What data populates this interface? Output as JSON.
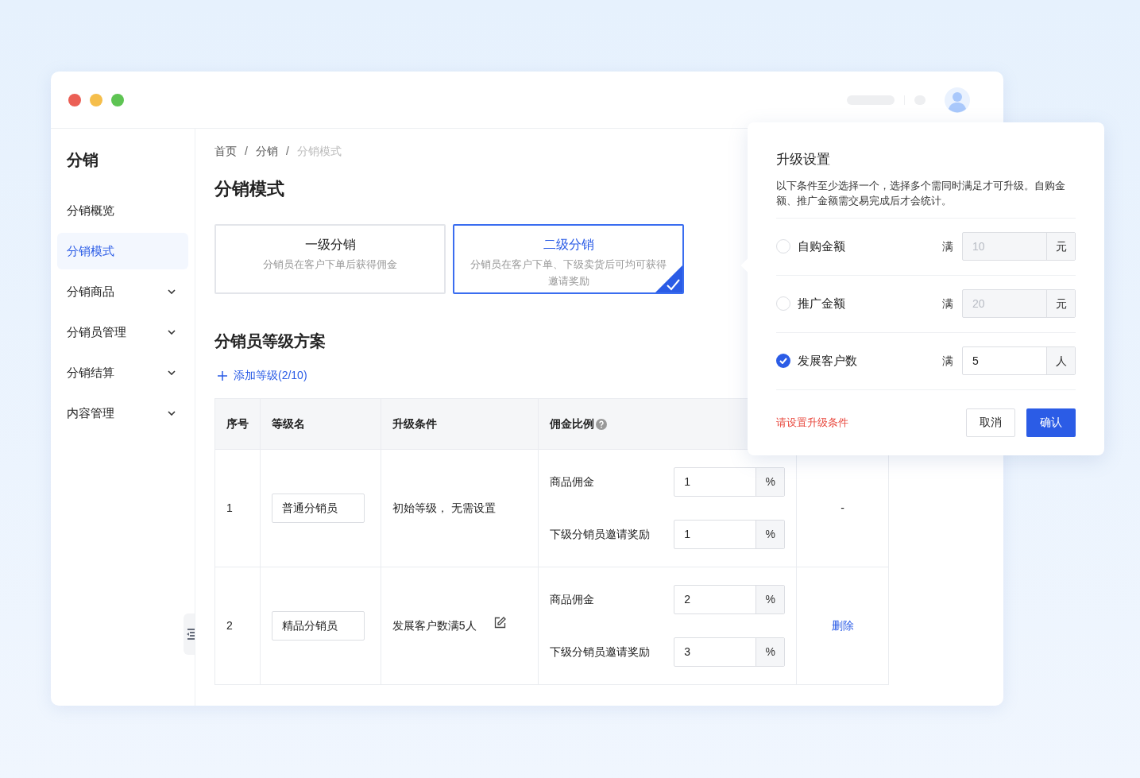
{
  "sidebar": {
    "title": "分销",
    "items": [
      {
        "label": "分销概览",
        "selected": false,
        "has_submenu": false
      },
      {
        "label": "分销模式",
        "selected": true,
        "has_submenu": false
      },
      {
        "label": "分销商品",
        "selected": false,
        "has_submenu": true
      },
      {
        "label": "分销员管理",
        "selected": false,
        "has_submenu": true
      },
      {
        "label": "分销结算",
        "selected": false,
        "has_submenu": true
      },
      {
        "label": "内容管理",
        "selected": false,
        "has_submenu": true
      }
    ]
  },
  "breadcrumb": {
    "separator": "/",
    "items": [
      {
        "label": "首页",
        "current": false
      },
      {
        "label": "分销",
        "current": false
      },
      {
        "label": "分销模式",
        "current": true
      }
    ]
  },
  "page_title": "分销模式",
  "modes": [
    {
      "title": "一级分销",
      "description": "分销员在客户下单后获得佣金",
      "selected": false
    },
    {
      "title": "二级分销",
      "description": "分销员在客户下单、下级卖货后可均可获得邀请奖励",
      "selected": true
    }
  ],
  "section_title": "分销员等级方案",
  "add_button": "添加等级(2/10)",
  "table": {
    "columns": [
      {
        "label": "序号",
        "help": false
      },
      {
        "label": "等级名",
        "help": false
      },
      {
        "label": "升级条件",
        "help": false
      },
      {
        "label": "佣金比例",
        "help": true
      }
    ],
    "rows": [
      {
        "index": "1",
        "name": "普通分销员",
        "condition": "初始等级， 无需设置",
        "condition_editable": false,
        "commissions": [
          {
            "label": "商品佣金",
            "value": "1",
            "unit": "%"
          },
          {
            "label": "下级分销员邀请奖励",
            "value": "1",
            "unit": "%"
          }
        ],
        "action": {
          "label": "-",
          "kind": "text"
        }
      },
      {
        "index": "2",
        "name": "精品分销员",
        "condition": "发展客户数满5人",
        "condition_editable": true,
        "commissions": [
          {
            "label": "商品佣金",
            "value": "2",
            "unit": "%"
          },
          {
            "label": "下级分销员邀请奖励",
            "value": "3",
            "unit": "%"
          }
        ],
        "action": {
          "label": "删除",
          "kind": "link"
        }
      }
    ]
  },
  "popover": {
    "title": "升级设置",
    "description": "以下条件至少选择一个，选择多个需同时满足才可升级。自购金额、推广金额需交易完成后才会统计。",
    "conditions": [
      {
        "label": "自购金额",
        "checked": false,
        "prefix": "满",
        "value": "10",
        "unit": "元"
      },
      {
        "label": "推广金额",
        "checked": false,
        "prefix": "满",
        "value": "20",
        "unit": "元"
      },
      {
        "label": "发展客户数",
        "checked": true,
        "prefix": "满",
        "value": "5",
        "unit": "人"
      }
    ],
    "error": "请设置升级条件",
    "buttons": [
      {
        "label": "取消",
        "kind": "secondary"
      },
      {
        "label": "确认",
        "kind": "primary"
      }
    ]
  }
}
